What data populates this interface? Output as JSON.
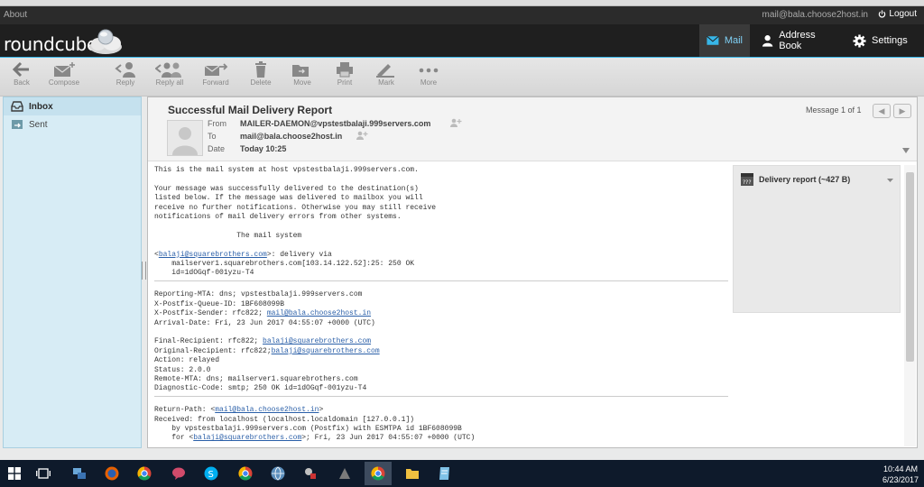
{
  "topbar": {
    "about": "About",
    "user": "mail@bala.choose2host.in",
    "logout": "Logout"
  },
  "header": {
    "logo": "roundcube",
    "nav": {
      "mail": "Mail",
      "address_book": "Address Book",
      "settings": "Settings"
    }
  },
  "toolbar": {
    "back": "Back",
    "compose": "Compose",
    "reply": "Reply",
    "reply_all": "Reply all",
    "forward": "Forward",
    "delete": "Delete",
    "move": "Move",
    "print": "Print",
    "mark": "Mark",
    "more": "More"
  },
  "folders": [
    {
      "name": "Inbox"
    },
    {
      "name": "Sent"
    }
  ],
  "message": {
    "subject": "Successful Mail Delivery Report",
    "from_label": "From",
    "from_value": "MAILER-DAEMON@vpstestbalaji.999servers.com",
    "to_label": "To",
    "to_value": "mail@bala.choose2host.in",
    "date_label": "Date",
    "date_value": "Today 10:25",
    "count": "Message 1 of 1",
    "attachment": "Delivery report (~427 B)",
    "body": {
      "p1": "This is the mail system at host vpstestbalaji.999servers.com.",
      "p2": "Your message was successfully delivered to the destination(s)\nlisted below. If the message was delivered to mailbox you will\nreceive no further notifications. Otherwise you may still receive\nnotifications of mail delivery errors from other systems.",
      "p3": "                   The mail system",
      "rcpt_link": "balaji@squarebrothers.com",
      "rcpt_rest": ">: delivery via\n    mailserver1.squarebrothers.com[103.14.122.52]:25: 250 OK\n    id=1dOGqf-001yzu-T4",
      "rep1": "Reporting-MTA: dns; vpstestbalaji.999servers.com\nX-Postfix-Queue-ID: 1BF608099B\nX-Postfix-Sender: rfc822; ",
      "sender_link": "mail@bala.choose2host.in",
      "rep2": "\nArrival-Date: Fri, 23 Jun 2017 04:55:07 +0000 (UTC)",
      "final_pre": "Final-Recipient: rfc822; ",
      "final_link": "balaji@squarebrothers.com",
      "orig_pre": "\nOriginal-Recipient: rfc822;",
      "orig_link": "balaji@squarebrothers.com",
      "rest": "\nAction: relayed\nStatus: 2.0.0\nRemote-MTA: dns; mailserver1.squarebrothers.com\nDiagnostic-Code: smtp; 250 OK id=1dOGqf-001yzu-T4",
      "rp_pre": "Return-Path: <",
      "rp_link": "mail@bala.choose2host.in",
      "rp_rest": ">\nReceived: from localhost (localhost.localdomain [127.0.0.1])\n    by vpstestbalaji.999servers.com (Postfix) with ESMTPA id 1BF608099B\n    for <",
      "for_link": "balaji@squarebrothers.com",
      "for_rest": ">; Fri, 23 Jun 2017 04:55:07 +0000 (UTC)"
    }
  },
  "taskbar": {
    "time": "10:44 AM",
    "date": "6/23/2017"
  },
  "colors": {
    "accent": "#37b6e8",
    "header_bg": "#1f1f1f",
    "sidebar_bg": "#d7ecf5",
    "taskbar_bg": "#0e1a2b"
  }
}
